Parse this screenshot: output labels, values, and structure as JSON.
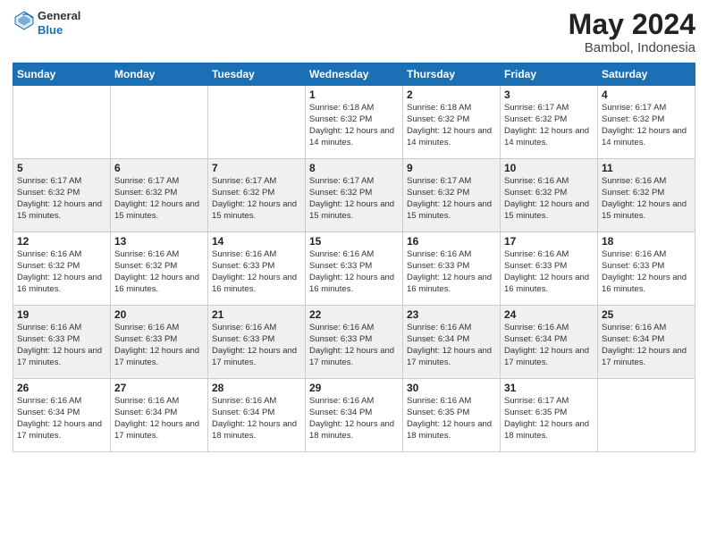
{
  "header": {
    "logo_general": "General",
    "logo_blue": "Blue",
    "month_year": "May 2024",
    "location": "Bambol, Indonesia"
  },
  "weekdays": [
    "Sunday",
    "Monday",
    "Tuesday",
    "Wednesday",
    "Thursday",
    "Friday",
    "Saturday"
  ],
  "weeks": [
    [
      {
        "day": "",
        "info": ""
      },
      {
        "day": "",
        "info": ""
      },
      {
        "day": "",
        "info": ""
      },
      {
        "day": "1",
        "info": "Sunrise: 6:18 AM\nSunset: 6:32 PM\nDaylight: 12 hours and 14 minutes."
      },
      {
        "day": "2",
        "info": "Sunrise: 6:18 AM\nSunset: 6:32 PM\nDaylight: 12 hours and 14 minutes."
      },
      {
        "day": "3",
        "info": "Sunrise: 6:17 AM\nSunset: 6:32 PM\nDaylight: 12 hours and 14 minutes."
      },
      {
        "day": "4",
        "info": "Sunrise: 6:17 AM\nSunset: 6:32 PM\nDaylight: 12 hours and 14 minutes."
      }
    ],
    [
      {
        "day": "5",
        "info": "Sunrise: 6:17 AM\nSunset: 6:32 PM\nDaylight: 12 hours and 15 minutes."
      },
      {
        "day": "6",
        "info": "Sunrise: 6:17 AM\nSunset: 6:32 PM\nDaylight: 12 hours and 15 minutes."
      },
      {
        "day": "7",
        "info": "Sunrise: 6:17 AM\nSunset: 6:32 PM\nDaylight: 12 hours and 15 minutes."
      },
      {
        "day": "8",
        "info": "Sunrise: 6:17 AM\nSunset: 6:32 PM\nDaylight: 12 hours and 15 minutes."
      },
      {
        "day": "9",
        "info": "Sunrise: 6:17 AM\nSunset: 6:32 PM\nDaylight: 12 hours and 15 minutes."
      },
      {
        "day": "10",
        "info": "Sunrise: 6:16 AM\nSunset: 6:32 PM\nDaylight: 12 hours and 15 minutes."
      },
      {
        "day": "11",
        "info": "Sunrise: 6:16 AM\nSunset: 6:32 PM\nDaylight: 12 hours and 15 minutes."
      }
    ],
    [
      {
        "day": "12",
        "info": "Sunrise: 6:16 AM\nSunset: 6:32 PM\nDaylight: 12 hours and 16 minutes."
      },
      {
        "day": "13",
        "info": "Sunrise: 6:16 AM\nSunset: 6:32 PM\nDaylight: 12 hours and 16 minutes."
      },
      {
        "day": "14",
        "info": "Sunrise: 6:16 AM\nSunset: 6:33 PM\nDaylight: 12 hours and 16 minutes."
      },
      {
        "day": "15",
        "info": "Sunrise: 6:16 AM\nSunset: 6:33 PM\nDaylight: 12 hours and 16 minutes."
      },
      {
        "day": "16",
        "info": "Sunrise: 6:16 AM\nSunset: 6:33 PM\nDaylight: 12 hours and 16 minutes."
      },
      {
        "day": "17",
        "info": "Sunrise: 6:16 AM\nSunset: 6:33 PM\nDaylight: 12 hours and 16 minutes."
      },
      {
        "day": "18",
        "info": "Sunrise: 6:16 AM\nSunset: 6:33 PM\nDaylight: 12 hours and 16 minutes."
      }
    ],
    [
      {
        "day": "19",
        "info": "Sunrise: 6:16 AM\nSunset: 6:33 PM\nDaylight: 12 hours and 17 minutes."
      },
      {
        "day": "20",
        "info": "Sunrise: 6:16 AM\nSunset: 6:33 PM\nDaylight: 12 hours and 17 minutes."
      },
      {
        "day": "21",
        "info": "Sunrise: 6:16 AM\nSunset: 6:33 PM\nDaylight: 12 hours and 17 minutes."
      },
      {
        "day": "22",
        "info": "Sunrise: 6:16 AM\nSunset: 6:33 PM\nDaylight: 12 hours and 17 minutes."
      },
      {
        "day": "23",
        "info": "Sunrise: 6:16 AM\nSunset: 6:34 PM\nDaylight: 12 hours and 17 minutes."
      },
      {
        "day": "24",
        "info": "Sunrise: 6:16 AM\nSunset: 6:34 PM\nDaylight: 12 hours and 17 minutes."
      },
      {
        "day": "25",
        "info": "Sunrise: 6:16 AM\nSunset: 6:34 PM\nDaylight: 12 hours and 17 minutes."
      }
    ],
    [
      {
        "day": "26",
        "info": "Sunrise: 6:16 AM\nSunset: 6:34 PM\nDaylight: 12 hours and 17 minutes."
      },
      {
        "day": "27",
        "info": "Sunrise: 6:16 AM\nSunset: 6:34 PM\nDaylight: 12 hours and 17 minutes."
      },
      {
        "day": "28",
        "info": "Sunrise: 6:16 AM\nSunset: 6:34 PM\nDaylight: 12 hours and 18 minutes."
      },
      {
        "day": "29",
        "info": "Sunrise: 6:16 AM\nSunset: 6:34 PM\nDaylight: 12 hours and 18 minutes."
      },
      {
        "day": "30",
        "info": "Sunrise: 6:16 AM\nSunset: 6:35 PM\nDaylight: 12 hours and 18 minutes."
      },
      {
        "day": "31",
        "info": "Sunrise: 6:17 AM\nSunset: 6:35 PM\nDaylight: 12 hours and 18 minutes."
      },
      {
        "day": "",
        "info": ""
      }
    ]
  ]
}
